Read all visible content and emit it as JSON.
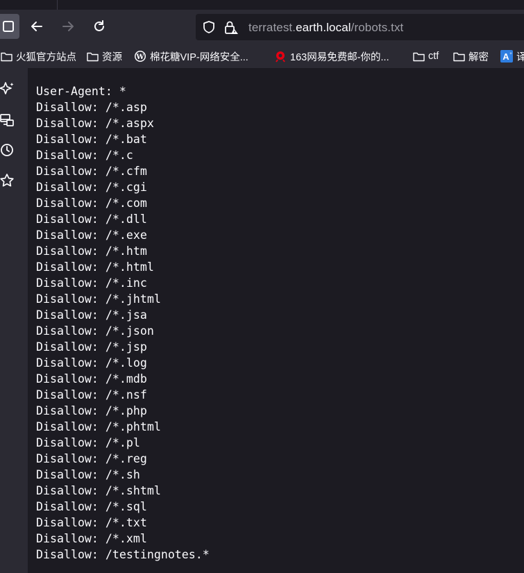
{
  "toolbar": {
    "url_prefix": "terratest.",
    "url_host": "earth.local",
    "url_path": "/robots.txt"
  },
  "bookmarks": [
    {
      "label": "火狐官方站点",
      "icon": "folder-icon"
    },
    {
      "label": "资源",
      "icon": "folder-icon"
    },
    {
      "label": "棉花糖VIP-网络安全...",
      "icon": "wordpress-icon"
    },
    {
      "label": "163网易免费邮-你的...",
      "icon": "netease-icon"
    },
    {
      "label": "ctf",
      "icon": "folder-icon"
    },
    {
      "label": "解密",
      "icon": "folder-icon"
    },
    {
      "label": "译",
      "icon": "translate-icon"
    }
  ],
  "sidebar": {
    "items": [
      "ai-sparkle-icon",
      "synced-tabs-icon",
      "history-icon",
      "bookmarks-star-icon"
    ]
  },
  "colors": {
    "toolbar_bg": "#2b2a33",
    "content_bg": "#1c1b22",
    "text": "#fbfbfe"
  },
  "robots": {
    "lines": [
      "User-Agent: *",
      "Disallow: /*.asp",
      "Disallow: /*.aspx",
      "Disallow: /*.bat",
      "Disallow: /*.c",
      "Disallow: /*.cfm",
      "Disallow: /*.cgi",
      "Disallow: /*.com",
      "Disallow: /*.dll",
      "Disallow: /*.exe",
      "Disallow: /*.htm",
      "Disallow: /*.html",
      "Disallow: /*.inc",
      "Disallow: /*.jhtml",
      "Disallow: /*.jsa",
      "Disallow: /*.json",
      "Disallow: /*.jsp",
      "Disallow: /*.log",
      "Disallow: /*.mdb",
      "Disallow: /*.nsf",
      "Disallow: /*.php",
      "Disallow: /*.phtml",
      "Disallow: /*.pl",
      "Disallow: /*.reg",
      "Disallow: /*.sh",
      "Disallow: /*.shtml",
      "Disallow: /*.sql",
      "Disallow: /*.txt",
      "Disallow: /*.xml",
      "Disallow: /testingnotes.*"
    ]
  }
}
